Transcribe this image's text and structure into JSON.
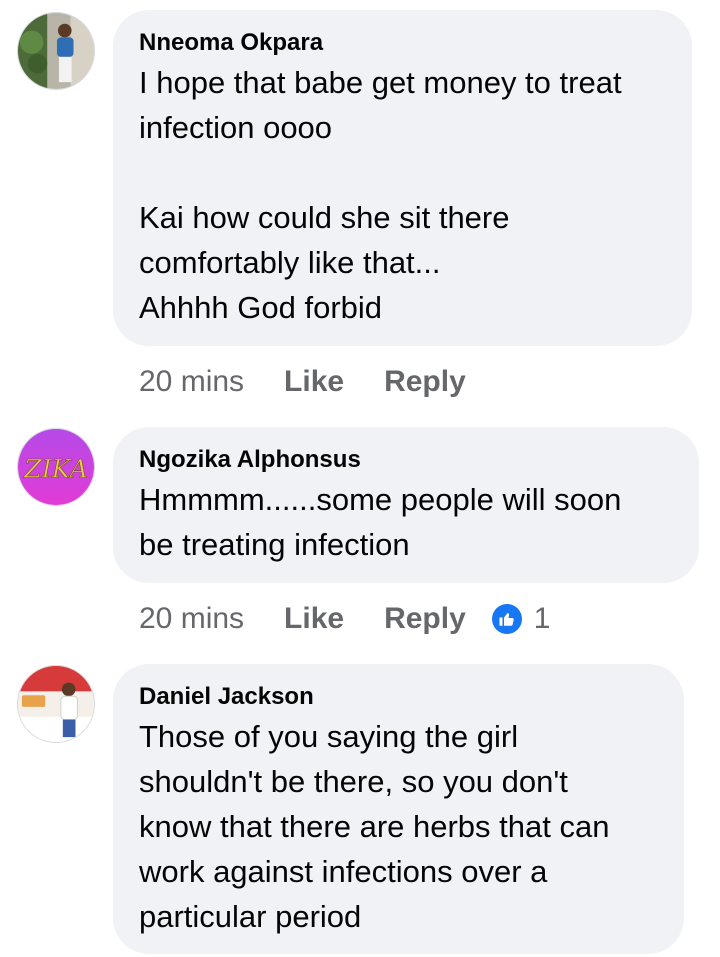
{
  "comments": [
    {
      "author": "Nneoma Okpara",
      "text": "I hope that babe get money to treat\ninfection oooo\n\nKai how could she sit there\ncomfortably like that...\nAhhhh God forbid",
      "time": "20 mins",
      "like_label": "Like",
      "reply_label": "Reply"
    },
    {
      "author": "Ngozika Alphonsus",
      "avatar_text": "ZIKA",
      "text": "Hmmmm......some people will soon\nbe treating infection",
      "time": "20 mins",
      "like_label": "Like",
      "reply_label": "Reply",
      "reaction_count": "1",
      "reaction_icon": "like-icon"
    },
    {
      "author": "Daniel Jackson",
      "text": "Those of you saying the girl\nshouldn't be there, so you don't\nknow that there are herbs that can\nwork against infections over a\nparticular period"
    }
  ],
  "colors": {
    "bubble": "#f0f2f5",
    "meta": "#65676b",
    "like_blue": "#1877f2",
    "text": "#050505"
  }
}
